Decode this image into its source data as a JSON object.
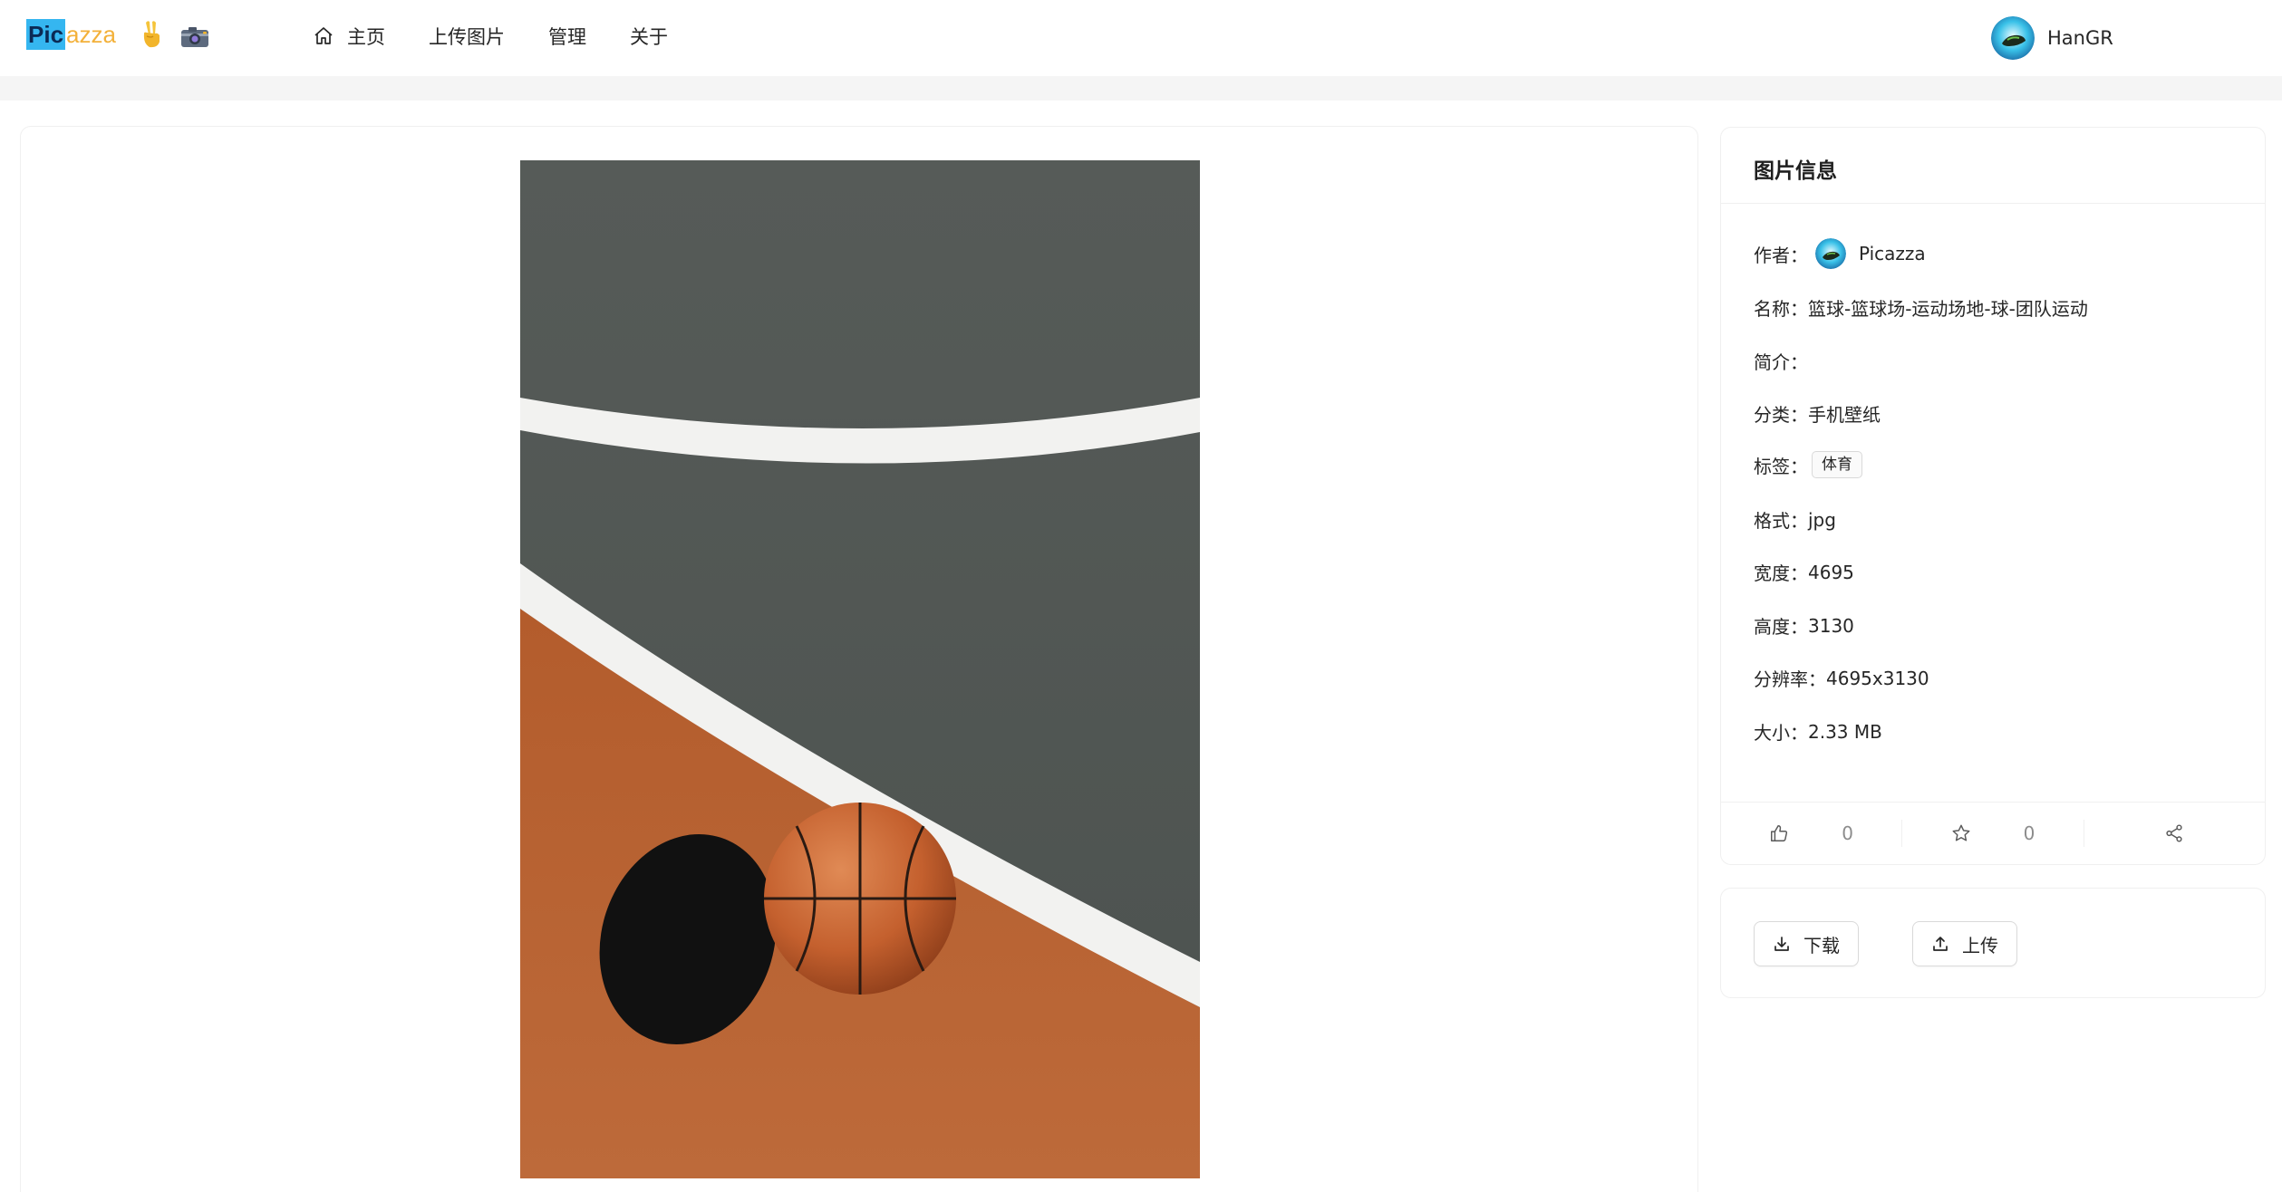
{
  "header": {
    "logo_pic": "Pic",
    "logo_rest": "azza",
    "nav": [
      {
        "label": "主页",
        "icon": "home-icon"
      },
      {
        "label": "上传图片"
      },
      {
        "label": "管理"
      },
      {
        "label": "关于"
      }
    ],
    "user": {
      "name": "HanGR"
    }
  },
  "image": {
    "alt": "篮球-篮球场-运动场地-球-团队运动"
  },
  "info": {
    "title": "图片信息",
    "author_label": "作者：",
    "author": "Picazza",
    "name_label": "名称：",
    "name": "篮球-篮球场-运动场地-球-团队运动",
    "intro_label": "简介：",
    "intro": "",
    "category_label": "分类：",
    "category": "手机壁纸",
    "tags_label": "标签：",
    "tags": [
      "体育"
    ],
    "format_label": "格式：",
    "format": "jpg",
    "width_label": "宽度：",
    "width": "4695",
    "height_label": "高度：",
    "height": "3130",
    "resolution_label": "分辨率：",
    "resolution": "4695x3130",
    "size_label": "大小：",
    "size": "2.33 MB"
  },
  "stats": {
    "likes": "0",
    "favorites": "0"
  },
  "buttons": {
    "download": "下载",
    "upload": "上传"
  },
  "colors": {
    "logo_blue": "#35b6f0",
    "logo_orange": "#f3b13a",
    "court_gray": "#4f5551",
    "court_orange": "#b5612f",
    "ball": "#c4602e"
  }
}
